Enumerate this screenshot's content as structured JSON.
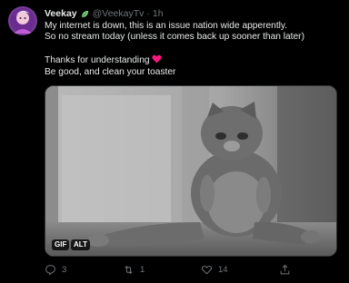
{
  "tweet": {
    "author_name": "Veekay",
    "handle": "@VeekayTv",
    "separator": "·",
    "time": "1h",
    "lines": [
      "My internet is down, this is an issue nation wide apperently.",
      "So no stream today (unless it comes back up sooner than later)",
      "",
      "Thanks for understanding",
      "Be good, and clean your toaster"
    ],
    "media": {
      "gif_label": "GIF",
      "alt_label": "ALT"
    },
    "actions": {
      "reply_count": "3",
      "retweet_count": "1",
      "like_count": "14",
      "share_count": ""
    }
  },
  "colors": {
    "background": "#000000",
    "text": "#e7e9ea",
    "muted": "#71767b",
    "heart": "#f91880",
    "badge": "#7ed37a"
  },
  "icons": [
    "avatar",
    "leaf-badge-icon",
    "heart-emoji-icon",
    "reply-icon",
    "retweet-icon",
    "like-icon",
    "share-icon"
  ]
}
